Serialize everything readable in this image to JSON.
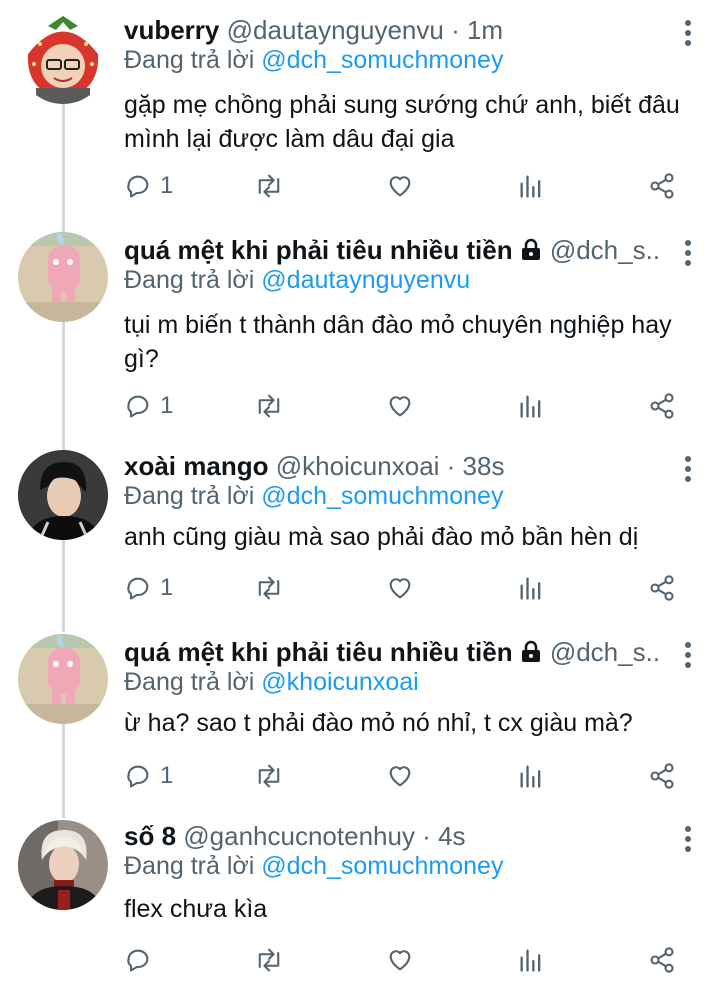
{
  "tweets": [
    {
      "name": "vuberry",
      "handle": "@dautaynguyenvu",
      "sep": " · ",
      "time": "1m",
      "reply_prefix": "Đang trả lời ",
      "reply_to": "@dch_somuchmoney",
      "text": "gặp mẹ chồng phải sung sướng chứ anh, biết đâu mình lại được làm dâu đại gia",
      "reply_count": "1",
      "avatar": "strawberry-costume-avatar",
      "locked": false
    },
    {
      "name": "quá mệt khi phải tiêu nhiều tiền",
      "handle": "@dch_s...",
      "sep": "",
      "time": "",
      "reply_prefix": "Đang trả lời ",
      "reply_to": "@dautaynguyenvu",
      "text": "tụi m biến t thành dân đào mỏ chuyên nghiệp hay gì?",
      "reply_count": "1",
      "avatar": "pink-rabbit-avatar",
      "locked": true
    },
    {
      "name": "xoài mango",
      "handle": "@khoicunxoai",
      "sep": " · ",
      "time": "38s",
      "reply_prefix": "Đang trả lời ",
      "reply_to": "@dch_somuchmoney",
      "text": "anh cũng giàu mà sao phải đào mỏ bần hèn dị",
      "reply_count": "1",
      "avatar": "person-photo-avatar",
      "locked": false
    },
    {
      "name": "quá mệt khi phải tiêu nhiều tiền",
      "handle": "@dch_s...",
      "sep": "",
      "time": "",
      "reply_prefix": "Đang trả lời ",
      "reply_to": "@khoicunxoai",
      "text": "ừ ha? sao t phải đào mỏ nó nhỉ, t cx giàu mà?",
      "reply_count": "1",
      "avatar": "pink-rabbit-avatar",
      "locked": true
    },
    {
      "name": "số 8",
      "handle": "@ganhcucnotenhuy",
      "sep": " · ",
      "time": "4s",
      "reply_prefix": "Đang trả lời ",
      "reply_to": "@dch_somuchmoney",
      "text": "flex chưa kìa",
      "reply_count": "",
      "avatar": "person-photo-avatar",
      "locked": false
    }
  ],
  "icons": {
    "reply": "reply-icon",
    "retweet": "retweet-icon",
    "like": "heart-icon",
    "views": "analytics-icon",
    "share": "share-icon",
    "more": "more-icon",
    "lock": "lock-icon"
  },
  "colors": {
    "text": "#0f1419",
    "muted": "#536471",
    "mention": "#1d9bf0",
    "thread_line": "#cfd9de"
  }
}
